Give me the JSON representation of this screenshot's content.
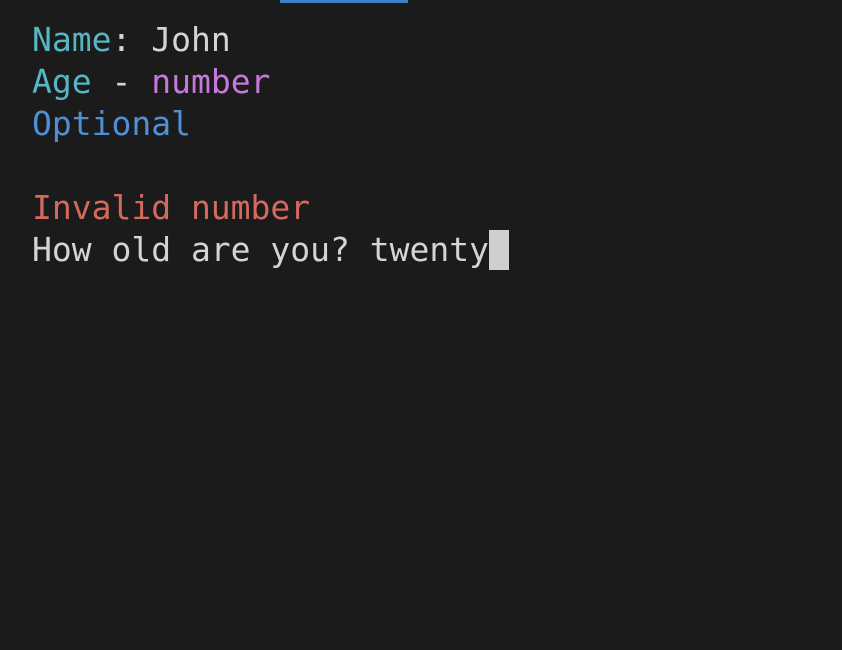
{
  "fields": {
    "name_label": "Name",
    "name_separator": ": ",
    "name_value": "John",
    "age_label": "Age",
    "age_separator": " - ",
    "age_type": "number",
    "optional_note": "Optional"
  },
  "error": {
    "message": "Invalid number"
  },
  "prompt": {
    "question": "How old are you? ",
    "input_value": "twenty"
  },
  "colors": {
    "background": "#1b1b1b",
    "label": "#56b6c2",
    "type_hint": "#c678dd",
    "optional": "#4f8fd6",
    "error": "#d46a5e",
    "text": "#d4d4d4",
    "tab_indicator": "#3b82c4"
  }
}
